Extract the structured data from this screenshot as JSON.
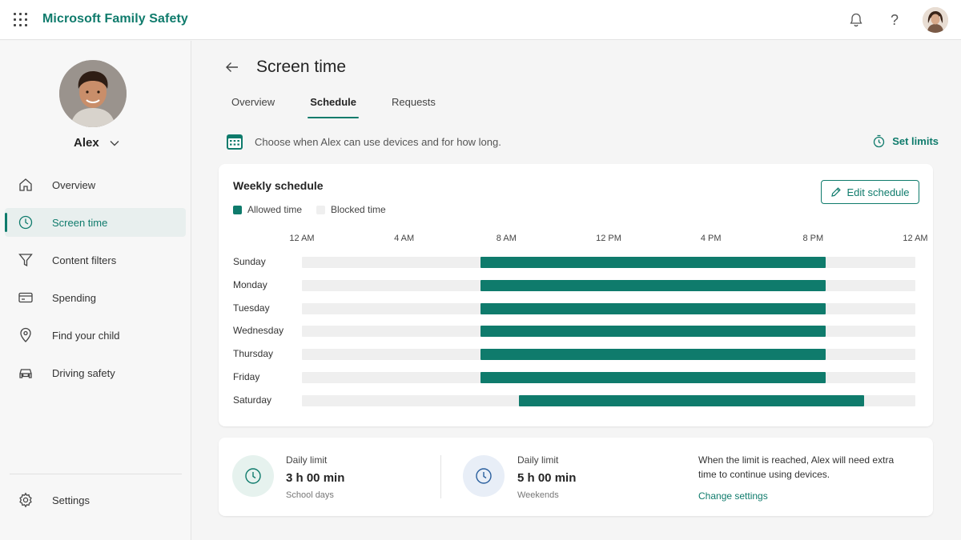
{
  "app": {
    "title": "Microsoft Family Safety",
    "waffle_icon": "app-launcher-icon",
    "bell_icon": "bell-icon",
    "help_icon": "help-icon",
    "help_glyph": "?"
  },
  "sidebar": {
    "child_name": "Alex",
    "items": [
      {
        "label": "Overview",
        "icon": "home-icon",
        "active": false
      },
      {
        "label": "Screen time",
        "icon": "clock-icon",
        "active": true
      },
      {
        "label": "Content filters",
        "icon": "filter-icon",
        "active": false
      },
      {
        "label": "Spending",
        "icon": "card-icon",
        "active": false
      },
      {
        "label": "Find your child",
        "icon": "location-icon",
        "active": false
      },
      {
        "label": "Driving safety",
        "icon": "car-icon",
        "active": false
      }
    ],
    "settings_label": "Settings"
  },
  "main": {
    "title": "Screen time",
    "tabs": [
      {
        "label": "Overview",
        "active": false
      },
      {
        "label": "Schedule",
        "active": true
      },
      {
        "label": "Requests",
        "active": false
      }
    ],
    "info_text": "Choose when Alex can use devices and for how long.",
    "set_limits_label": "Set limits"
  },
  "weekly": {
    "title": "Weekly schedule",
    "edit_label": "Edit schedule",
    "legend": [
      {
        "label": "Allowed time",
        "color": "#0f7b6c"
      },
      {
        "label": "Blocked time",
        "color": "#efefef"
      }
    ]
  },
  "chart_data": {
    "type": "bar",
    "orientation": "horizontal-range",
    "x_ticks": [
      "12 AM",
      "4 AM",
      "8 AM",
      "12 PM",
      "4 PM",
      "8 PM",
      "12 AM"
    ],
    "x_range_hours": [
      0,
      24
    ],
    "categories": [
      "Sunday",
      "Monday",
      "Tuesday",
      "Wednesday",
      "Thursday",
      "Friday",
      "Saturday"
    ],
    "allowed_start_hours": [
      7,
      7,
      7,
      7,
      7,
      7,
      8.5
    ],
    "allowed_end_hours": [
      20.5,
      20.5,
      20.5,
      20.5,
      20.5,
      20.5,
      22
    ]
  },
  "limits": {
    "school": {
      "caption": "Daily limit",
      "value": "3 h 00 min",
      "sub": "School days"
    },
    "weekend": {
      "caption": "Daily limit",
      "value": "5 h 00 min",
      "sub": "Weekends"
    },
    "note": "When the limit is reached, Alex will need extra time to continue using devices.",
    "change_label": "Change settings"
  }
}
